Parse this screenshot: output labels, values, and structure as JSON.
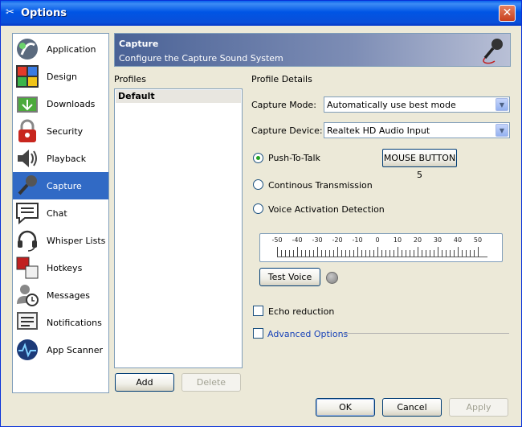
{
  "window": {
    "title": "Options",
    "close_symbol": "✕"
  },
  "sidebar": {
    "items": [
      {
        "label": "Application",
        "icon": "application-icon"
      },
      {
        "label": "Design",
        "icon": "design-icon"
      },
      {
        "label": "Downloads",
        "icon": "downloads-icon"
      },
      {
        "label": "Security",
        "icon": "security-lock-icon"
      },
      {
        "label": "Playback",
        "icon": "playback-speaker-icon"
      },
      {
        "label": "Capture",
        "icon": "microphone-icon",
        "selected": true
      },
      {
        "label": "Chat",
        "icon": "chat-icon"
      },
      {
        "label": "Whisper Lists",
        "icon": "headset-icon"
      },
      {
        "label": "Hotkeys",
        "icon": "hotkeys-icon"
      },
      {
        "label": "Messages",
        "icon": "messages-icon"
      },
      {
        "label": "Notifications",
        "icon": "notifications-icon"
      },
      {
        "label": "App Scanner",
        "icon": "app-scanner-icon"
      }
    ]
  },
  "header": {
    "title": "Capture",
    "subtitle": "Configure the Capture Sound System",
    "icon": "microphone-icon"
  },
  "profiles": {
    "label": "Profiles",
    "items": [
      "Default"
    ],
    "add_label": "Add",
    "delete_label": "Delete"
  },
  "details": {
    "label": "Profile Details",
    "capture_mode": {
      "label": "Capture Mode:",
      "value": "Automatically use best mode"
    },
    "capture_device": {
      "label": "Capture Device:",
      "value": "Realtek HD Audio Input"
    },
    "push_to_talk": {
      "label": "Push-To-Talk",
      "checked": true,
      "hotkey": "MOUSE BUTTON 5"
    },
    "continuous": {
      "label": "Continous Transmission",
      "checked": false
    },
    "voice_activation": {
      "label": "Voice Activation Detection",
      "checked": false
    },
    "meter": {
      "tick_labels": [
        "-50",
        "-40",
        "-30",
        "-20",
        "-10",
        "0",
        "10",
        "20",
        "30",
        "40",
        "50"
      ]
    },
    "test_voice_label": "Test Voice",
    "echo_reduction": {
      "label": "Echo reduction",
      "checked": false
    },
    "advanced_options": {
      "label": "Advanced Options",
      "checked": false
    }
  },
  "footer": {
    "ok_label": "OK",
    "cancel_label": "Cancel",
    "apply_label": "Apply"
  },
  "colors": {
    "titlebar": "#0055e5",
    "selection": "#316ac5",
    "header": "#4a6296",
    "link": "#1a44b8"
  }
}
